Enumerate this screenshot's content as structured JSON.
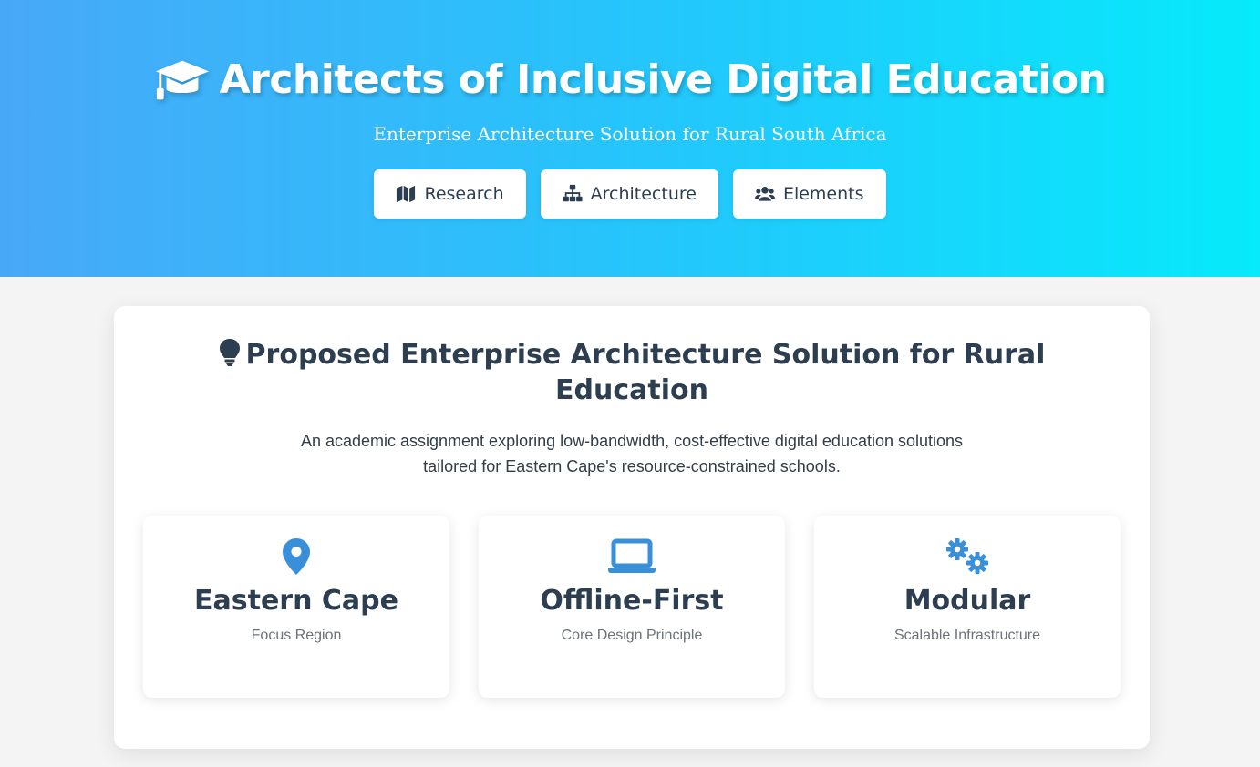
{
  "header": {
    "title": "Architects of Inclusive Digital Education",
    "subtitle": "Enterprise Architecture Solution for Rural South Africa",
    "icon": "graduation-cap-icon"
  },
  "nav": {
    "items": [
      {
        "label": "Research",
        "icon": "map-icon"
      },
      {
        "label": "Architecture",
        "icon": "sitemap-icon"
      },
      {
        "label": "Elements",
        "icon": "users-icon"
      }
    ]
  },
  "main": {
    "title": "Proposed Enterprise Architecture Solution for Rural Education",
    "title_icon": "lightbulb-icon",
    "description": "An academic assignment exploring low-bandwidth, cost-effective digital education solutions tailored for Eastern Cape's resource-constrained schools.",
    "features": [
      {
        "title": "Eastern Cape",
        "subtitle": "Focus Region",
        "icon": "map-marker-icon"
      },
      {
        "title": "Offline-First",
        "subtitle": "Core Design Principle",
        "icon": "laptop-icon"
      },
      {
        "title": "Modular",
        "subtitle": "Scalable Infrastructure",
        "icon": "cogs-icon"
      }
    ]
  },
  "colors": {
    "gradient_start": "#48a8f8",
    "gradient_end": "#06eafb",
    "heading_text": "#2c3e50",
    "feature_icon": "#3a8fd9"
  }
}
